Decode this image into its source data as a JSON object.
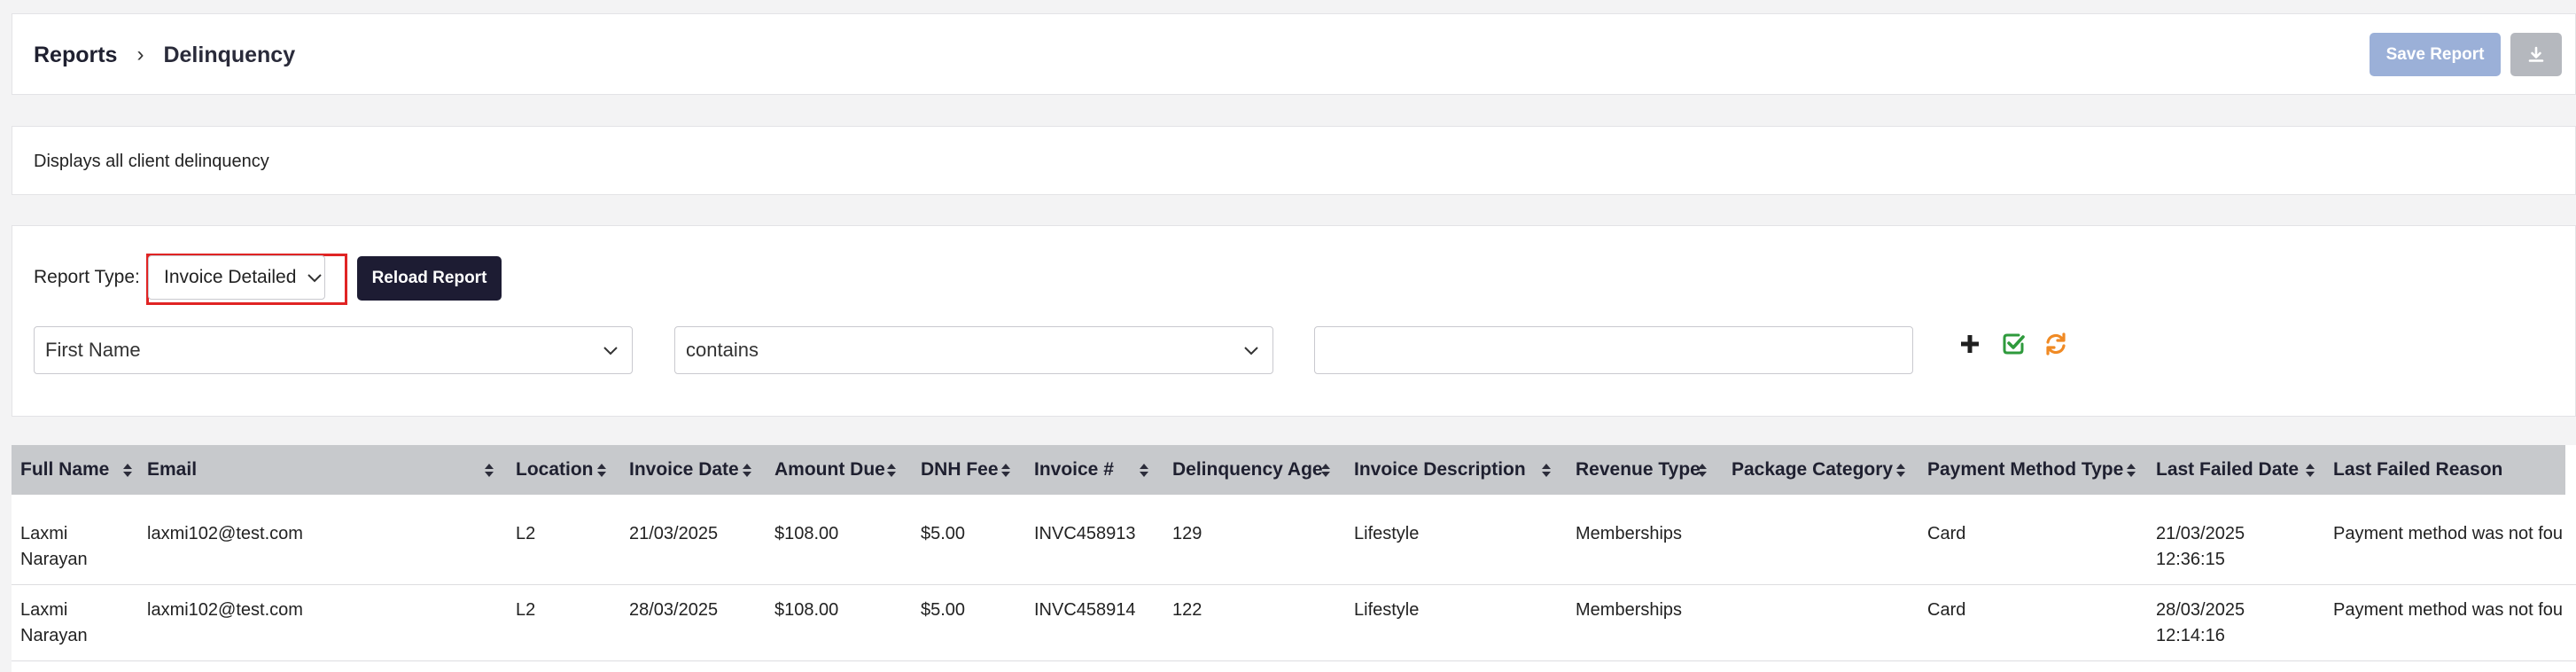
{
  "breadcrumb": {
    "root": "Reports",
    "separator": "›",
    "current": "Delinquency"
  },
  "toolbar": {
    "save_label": "Save Report",
    "download_icon": "download-icon"
  },
  "description": "Displays all client delinquency",
  "report_type": {
    "label": "Report Type:",
    "selected": "Invoice Detailed",
    "reload_label": "Reload Report"
  },
  "filter": {
    "field": "First Name",
    "operator": "contains",
    "value": "",
    "add_icon": "plus-icon",
    "apply_icon": "check-square-icon",
    "reset_icon": "refresh-icon"
  },
  "colors": {
    "brand_dark": "#1d1c33",
    "save_disabled": "#9bb0d8",
    "highlight": "#e02424",
    "apply_green": "#2e9a3c",
    "reset_orange": "#f08a24",
    "header_bg": "#c7c9cc"
  },
  "table": {
    "columns": [
      "Full Name",
      "Email",
      "Location",
      "Invoice Date",
      "Amount Due",
      "DNH Fee",
      "Invoice #",
      "Delinquency Age",
      "Invoice Description",
      "Revenue Type",
      "Package Category",
      "Payment Method Type",
      "Last Failed Date",
      "Last Failed Reason"
    ],
    "rows": [
      {
        "full_name": "Laxmi Narayan",
        "email": "laxmi102@test.com",
        "location": "L2",
        "invoice_date": "21/03/2025",
        "amount_due": "$108.00",
        "dnh_fee": "$5.00",
        "invoice_no": "INVC458913",
        "delinquency_age": "129",
        "invoice_description": "Lifestyle",
        "revenue_type": "Memberships",
        "package_category": "",
        "payment_method_type": "Card",
        "last_failed_date": "21/03/2025",
        "last_failed_time": "12:36:15",
        "last_failed_reason": "Payment method was not fou"
      },
      {
        "full_name": "Laxmi Narayan",
        "email": "laxmi102@test.com",
        "location": "L2",
        "invoice_date": "28/03/2025",
        "amount_due": "$108.00",
        "dnh_fee": "$5.00",
        "invoice_no": "INVC458914",
        "delinquency_age": "122",
        "invoice_description": "Lifestyle",
        "revenue_type": "Memberships",
        "package_category": "",
        "payment_method_type": "Card",
        "last_failed_date": "28/03/2025",
        "last_failed_time": "12:14:16",
        "last_failed_reason": "Payment method was not fou"
      }
    ]
  }
}
